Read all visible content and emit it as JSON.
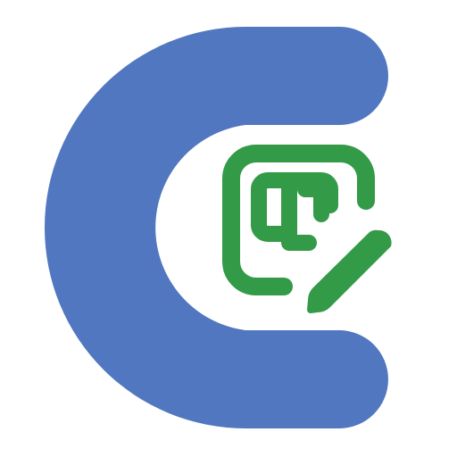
{
  "logo": {
    "name": "app-logo",
    "colors": {
      "c_shape": "#5077bf",
      "glyph": "#339a48",
      "background": "#ffffff"
    }
  }
}
